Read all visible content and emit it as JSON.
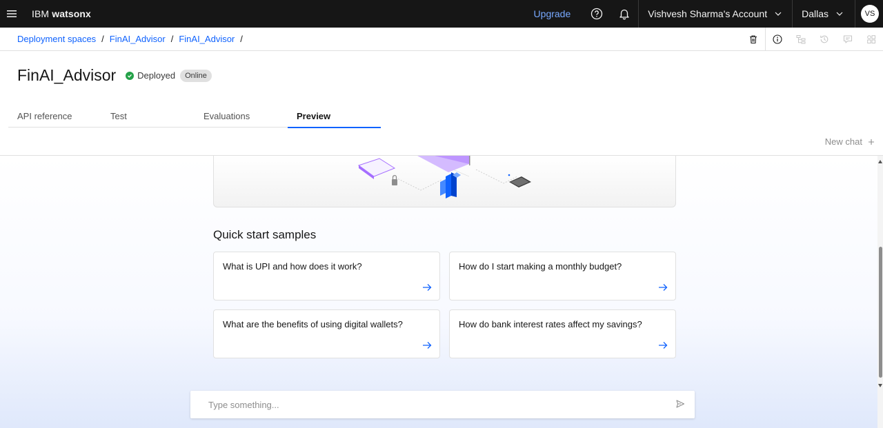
{
  "topbar": {
    "brand_prefix": "IBM",
    "brand_product": "watsonx",
    "upgrade_label": "Upgrade",
    "account_label": "Vishvesh Sharma's Account",
    "region_label": "Dallas",
    "avatar_initials": "VS"
  },
  "breadcrumb": {
    "items": [
      "Deployment spaces",
      "FinAI_Advisor",
      "FinAI_Advisor"
    ],
    "separator": "/"
  },
  "header": {
    "title": "FinAI_Advisor",
    "status": "Deployed",
    "tag": "Online"
  },
  "tabs": [
    {
      "label": "API reference"
    },
    {
      "label": "Test"
    },
    {
      "label": "Evaluations"
    },
    {
      "label": "Preview"
    }
  ],
  "chat": {
    "new_chat_label": "New chat",
    "quick_start_title": "Quick start samples",
    "samples": [
      {
        "question": "What is UPI and how does it work?"
      },
      {
        "question": "How do I start making a monthly budget?"
      },
      {
        "question": "What are the benefits of using digital wallets?"
      },
      {
        "question": "How do bank interest rates affect my savings?"
      }
    ],
    "input_placeholder": "Type something..."
  },
  "colors": {
    "topbar_bg": "#161616",
    "link": "#0f62fe",
    "upgrade": "#78a9ff",
    "success": "#24a148",
    "hero_purple": "#a56eff",
    "hero_blue": "#0f62fe"
  }
}
